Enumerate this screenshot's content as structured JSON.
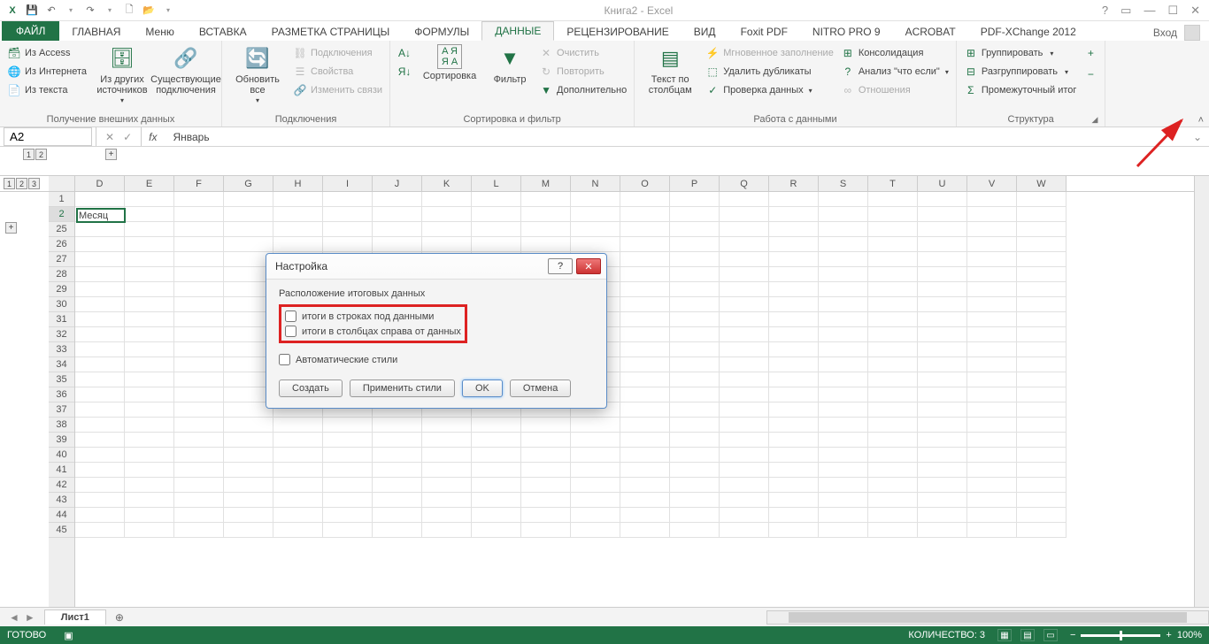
{
  "app": {
    "title": "Книга2 - Excel"
  },
  "qat": {
    "save": "💾",
    "undo": "↶",
    "redo": "↷",
    "new": "🗋",
    "open": "📂"
  },
  "winbtns": {
    "help": "?",
    "ropts": "▭",
    "min": "—",
    "max": "☐",
    "close": "✕"
  },
  "tabs": {
    "file": "ФАЙЛ",
    "home": "ГЛАВНАЯ",
    "menu": "Меню",
    "insert": "ВСТАВКА",
    "layout": "РАЗМЕТКА СТРАНИЦЫ",
    "formulas": "ФОРМУЛЫ",
    "data": "ДАННЫЕ",
    "review": "РЕЦЕНЗИРОВАНИЕ",
    "view": "ВИД",
    "foxit": "Foxit PDF",
    "nitro": "NITRO PRO 9",
    "acrobat": "ACROBAT",
    "pdfx": "PDF-XChange 2012",
    "signin": "Вход"
  },
  "ribbon": {
    "ext": {
      "access": "Из Access",
      "web": "Из Интернета",
      "text": "Из текста",
      "other": "Из других источников",
      "existing": "Существующие подключения",
      "label": "Получение внешних данных"
    },
    "conn": {
      "refresh": "Обновить все",
      "connections": "Подключения",
      "props": "Свойства",
      "links": "Изменить связи",
      "label": "Подключения"
    },
    "sort": {
      "az": "А↓Я",
      "za": "Я↓А",
      "sort": "Сортировка",
      "filter": "Фильтр",
      "clear": "Очистить",
      "reapply": "Повторить",
      "adv": "Дополнительно",
      "label": "Сортировка и фильтр"
    },
    "tools": {
      "ttc": "Текст по столбцам",
      "flash": "Мгновенное заполнение",
      "dup": "Удалить дубликаты",
      "val": "Проверка данных",
      "cons": "Консолидация",
      "whatif": "Анализ \"что если\"",
      "rel": "Отношения",
      "label": "Работа с данными"
    },
    "outline": {
      "group": "Группировать",
      "ungroup": "Разгруппировать",
      "sub": "Промежуточный итог",
      "label": "Структура"
    }
  },
  "fbar": {
    "name": "A2",
    "formula": "Январь"
  },
  "outline_levels": {
    "cols": [
      "1",
      "2"
    ],
    "rows": [
      "1",
      "2",
      "3"
    ]
  },
  "cols": [
    "D",
    "E",
    "F",
    "G",
    "H",
    "I",
    "J",
    "K",
    "L",
    "M",
    "N",
    "O",
    "P",
    "Q",
    "R",
    "S",
    "T",
    "U",
    "V",
    "W"
  ],
  "rows_top": [
    "1",
    "2"
  ],
  "rows_rest": [
    "25",
    "26",
    "27",
    "28",
    "29",
    "30",
    "31",
    "32",
    "33",
    "34",
    "35",
    "36",
    "37",
    "38",
    "39",
    "40",
    "41",
    "42",
    "43",
    "44",
    "45"
  ],
  "cells": {
    "A2": "Месяц"
  },
  "dialog": {
    "title": "Настройка",
    "group": "Расположение итоговых данных",
    "chk1": "итоги в строках под данными",
    "chk2": "итоги в столбцах справа от данных",
    "chk3": "Автоматические стили",
    "create": "Создать",
    "apply": "Применить стили",
    "ok": "OK",
    "cancel": "Отмена"
  },
  "sheet": {
    "name": "Лист1",
    "add": "⊕"
  },
  "status": {
    "ready": "ГОТОВО",
    "count": "КОЛИЧЕСТВО: 3",
    "zoom": "100%"
  }
}
